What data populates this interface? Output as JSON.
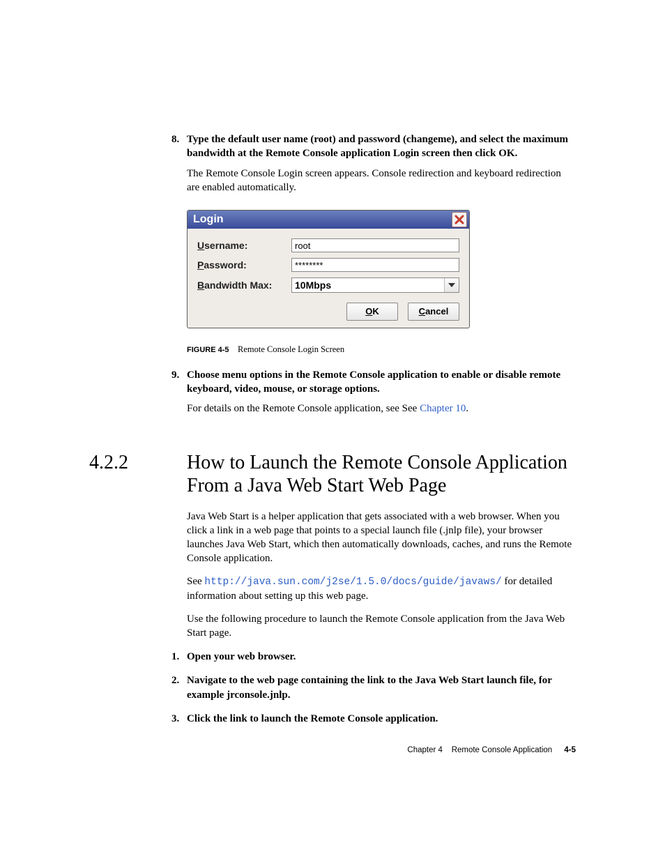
{
  "steps_a": {
    "n8": "8.",
    "s8": "Type the default user name (root) and password (changeme), and select the maximum bandwidth at the Remote Console application Login screen then click OK.",
    "p8": "The Remote Console Login screen appears. Console redirection and keyboard redirection are enabled automatically."
  },
  "login": {
    "title": "Login",
    "username_label_first": "U",
    "username_label_rest": "sername:",
    "username_value": "root",
    "password_label_first": "P",
    "password_label_rest": "assword:",
    "password_value": "********",
    "bw_label_first": "B",
    "bw_label_rest": "andwidth Max:",
    "bw_value": "10Mbps",
    "ok_first": "O",
    "ok_rest": "K",
    "cancel_first": "C",
    "cancel_rest": "ancel"
  },
  "figure": {
    "label": "FIGURE 4-5",
    "caption": "Remote Console Login Screen"
  },
  "steps_b": {
    "n9": "9.",
    "s9": "Choose menu options in the Remote Console application to enable or disable remote keyboard, video, mouse, or storage options.",
    "p9a": "For details on the Remote Console application, see See ",
    "p9link": "Chapter 10",
    "p9b": "."
  },
  "section": {
    "num": "4.2.2",
    "title": "How to Launch the Remote Console Application From a Java Web Start Web Page"
  },
  "body": {
    "p1": "Java Web Start is a helper application that gets associated with a web browser. When you click a link in a web page that points to a special launch file (.jnlp file), your browser launches Java Web Start, which then automatically downloads, caches, and runs the Remote Console application.",
    "p2a": "See ",
    "p2url": "http://java.sun.com/j2se/1.5.0/docs/guide/javaws/",
    "p2b": " for detailed information about setting up this web page.",
    "p3": "Use the following procedure to launch the Remote Console application from the Java Web Start page."
  },
  "steps_c": {
    "n1": "1.",
    "s1": "Open your web browser.",
    "n2": "2.",
    "s2": "Navigate to the web page containing the link to the Java Web Start launch file, for example jrconsole.jnlp.",
    "n3": "3.",
    "s3": "Click the link to launch the Remote Console application."
  },
  "footer": {
    "chapter": "Chapter 4",
    "title": "Remote Console Application",
    "page": "4-5"
  }
}
